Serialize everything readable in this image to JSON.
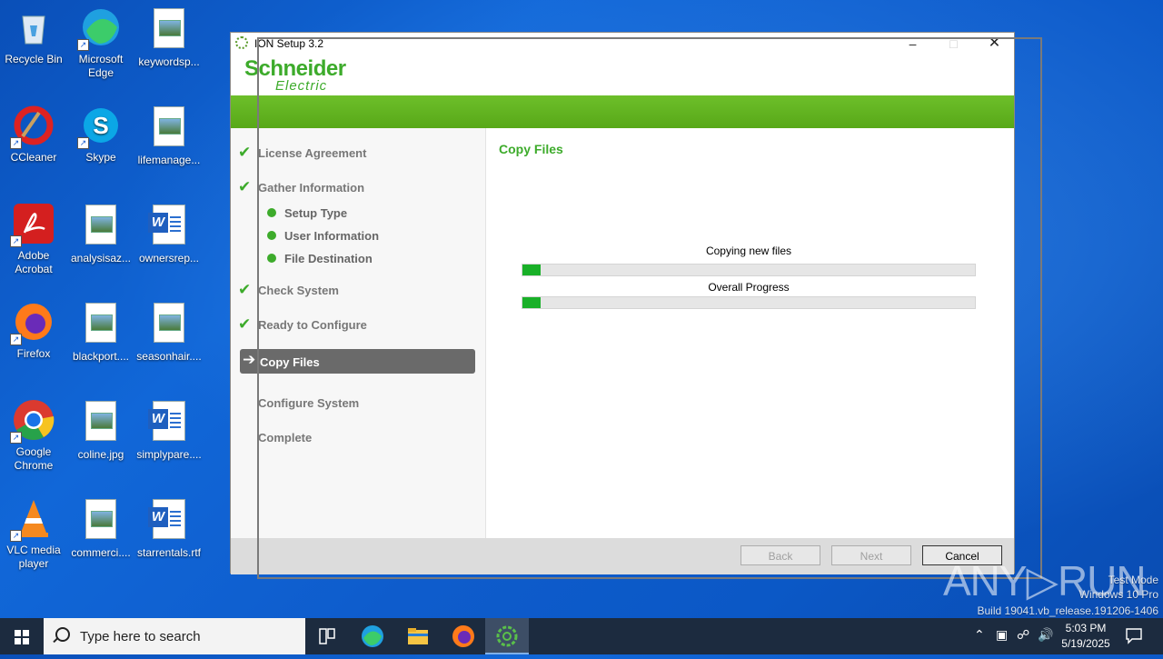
{
  "desktop": {
    "icons": [
      {
        "label": "Recycle Bin",
        "icon": "recycle-bin-icon"
      },
      {
        "label": "Microsoft Edge",
        "icon": "edge-icon"
      },
      {
        "label": "keywordsp...",
        "icon": "image-file-icon"
      },
      {
        "label": "CCleaner",
        "icon": "ccleaner-icon"
      },
      {
        "label": "Skype",
        "icon": "skype-icon"
      },
      {
        "label": "lifemanage...",
        "icon": "image-file-icon"
      },
      {
        "label": "Adobe Acrobat",
        "icon": "acrobat-icon"
      },
      {
        "label": "analysisaz...",
        "icon": "image-file-icon"
      },
      {
        "label": "ownersrep...",
        "icon": "word-doc-icon"
      },
      {
        "label": "Firefox",
        "icon": "firefox-icon"
      },
      {
        "label": "blackport....",
        "icon": "image-file-icon"
      },
      {
        "label": "seasonhair....",
        "icon": "image-file-icon"
      },
      {
        "label": "Google Chrome",
        "icon": "chrome-icon"
      },
      {
        "label": "coline.jpg",
        "icon": "image-file-icon"
      },
      {
        "label": "simplypare....",
        "icon": "word-doc-icon"
      },
      {
        "label": "VLC media player",
        "icon": "vlc-icon"
      },
      {
        "label": "commerci....",
        "icon": "image-file-icon"
      },
      {
        "label": "starrentals.rtf",
        "icon": "word-doc-icon"
      }
    ]
  },
  "window": {
    "title": "ION Setup 3.2",
    "brand_line1": "Schneider",
    "brand_line2": "Electric",
    "steps": [
      {
        "label": "License Agreement",
        "state": "done"
      },
      {
        "label": "Gather Information",
        "state": "done"
      },
      {
        "label": "Check System",
        "state": "done"
      },
      {
        "label": "Ready to Configure",
        "state": "done"
      },
      {
        "label": "Copy Files",
        "state": "current"
      },
      {
        "label": "Configure System",
        "state": "pending"
      },
      {
        "label": "Complete",
        "state": "pending"
      }
    ],
    "substeps": [
      "Setup Type",
      "User Information",
      "File Destination"
    ],
    "content_title": "Copy Files",
    "progress1_label": "Copying new files",
    "progress1_fraction": 0.04,
    "progress2_label": "Overall Progress",
    "progress2_fraction": 0.04,
    "buttons": {
      "back": "Back",
      "next": "Next",
      "cancel": "Cancel"
    },
    "colors": {
      "accent": "#3dab2b",
      "bar_fill": "#19b028"
    }
  },
  "watermark": {
    "brand": "ANY▷RUN",
    "line1": "Test Mode",
    "line2": "Windows 10 Pro",
    "line3": "Build 19041.vb_release.191206-1406"
  },
  "taskbar": {
    "search_placeholder": "Type here to search",
    "time": "5:03 PM",
    "date": "5/19/2025"
  }
}
